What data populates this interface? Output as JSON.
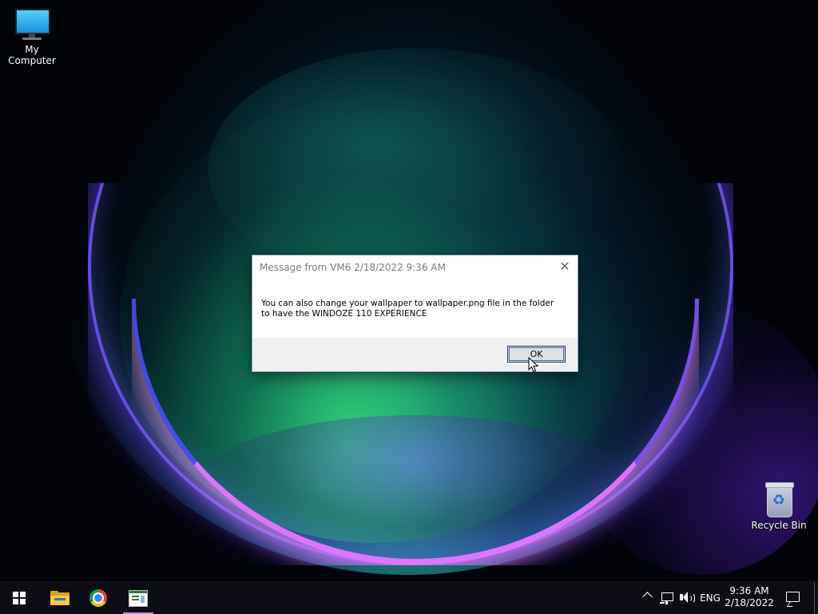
{
  "desktop": {
    "icons": [
      {
        "label": "My Computer",
        "icon": "computer-icon"
      },
      {
        "label": "Recycle Bin",
        "icon": "recycle-bin-icon"
      }
    ]
  },
  "dialog": {
    "title": "Message from VM6 2/18/2022 9:36 AM",
    "message_line1": "You can also change your wallpaper to wallpaper.png file in the folder",
    "message_line2": "to have the WINDOZE 110 EXPERIENCE",
    "ok_label": "OK"
  },
  "taskbar": {
    "apps": [
      {
        "name": "start",
        "icon": "windows-logo-icon"
      },
      {
        "name": "file-explorer",
        "icon": "folder-icon"
      },
      {
        "name": "chrome",
        "icon": "chrome-icon"
      },
      {
        "name": "message-app",
        "icon": "app-window-icon",
        "active": true
      }
    ],
    "tray": {
      "language": "ENG",
      "time": "9:36 AM",
      "date": "2/18/2022"
    }
  },
  "colors": {
    "taskbar": "#0c0c14",
    "dialog_footer": "#f0f0f0",
    "active_indicator": "#c084fc",
    "ok_focus": "#2d6fcf"
  }
}
